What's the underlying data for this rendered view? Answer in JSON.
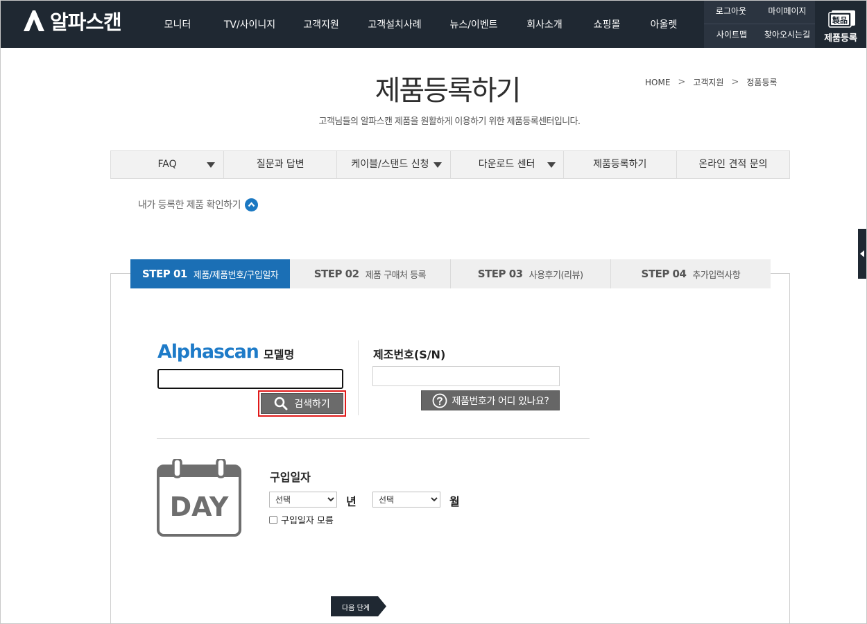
{
  "header": {
    "logo_text": "알파스캔",
    "nav": [
      "모니터",
      "TV/사이니지",
      "고객지원",
      "고객설치사례",
      "뉴스/이벤트",
      "회사소개",
      "쇼핑몰",
      "아울렛"
    ],
    "util": [
      "로그아웃",
      "마이페이지",
      "사이트맵",
      "찾아오시는길"
    ],
    "register_badge": {
      "label": "제품등록",
      "icon": "register-icon",
      "icon_text": "製品"
    }
  },
  "page": {
    "title": "제품등록하기",
    "subtitle": "고객님들의 알파스캔 제품을 원활하게 이용하기 위한 제품등록센터입니다.",
    "breadcrumb": [
      "HOME",
      "고객지원",
      "정품등록"
    ]
  },
  "subtabs": [
    {
      "label": "FAQ",
      "dropdown": true
    },
    {
      "label": "질문과 답변",
      "dropdown": false
    },
    {
      "label": "케이블/스탠드 신청",
      "dropdown": true
    },
    {
      "label": "다운로드 센터",
      "dropdown": true
    },
    {
      "label": "제품등록하기",
      "dropdown": false
    },
    {
      "label": "온라인 견적 문의",
      "dropdown": false
    }
  ],
  "my_products": {
    "label": "내가 등록한 제품 확인하기",
    "icon": "chevron-up-icon"
  },
  "steps": [
    {
      "num": "STEP 01",
      "label": "제품/제품번호/구입일자",
      "active": true
    },
    {
      "num": "STEP 02",
      "label": "제품 구매처 등록",
      "active": false
    },
    {
      "num": "STEP 03",
      "label": "사용후기(리뷰)",
      "active": false
    },
    {
      "num": "STEP 04",
      "label": "추가입력사항",
      "active": false
    }
  ],
  "model": {
    "brand_logo": "Alphascan",
    "label": "모델명",
    "value": "",
    "search_label": "검색하기"
  },
  "serial": {
    "label": "제조번호(S/N)",
    "value": "",
    "help_label": "제품번호가 어디 있나요?"
  },
  "purchase": {
    "label": "구입일자",
    "day_text": "DAY",
    "year": {
      "selected": "선택",
      "unit": "년"
    },
    "month": {
      "selected": "선택",
      "unit": "월"
    },
    "unknown_label": "구입일자 모름",
    "unknown_checked": false
  },
  "next_label": "다음 단계",
  "colors": {
    "header_bg": "#1f2832",
    "accent_blue": "#1b6fb5",
    "highlight_red": "#e01919",
    "button_gray": "#666666"
  }
}
